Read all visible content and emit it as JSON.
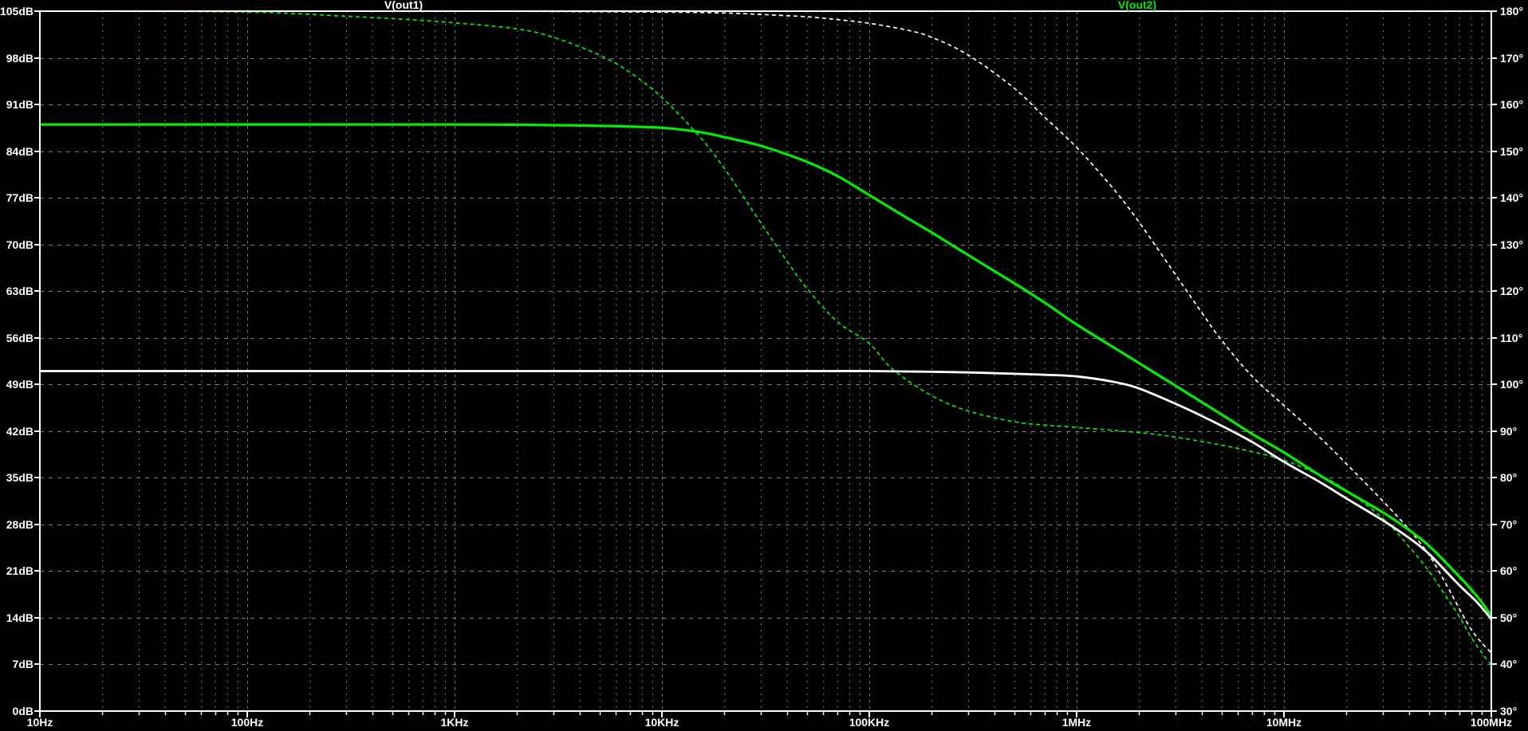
{
  "window": {
    "background_color": "#000000",
    "grid_color": "#7d7d7d",
    "axis_color": "#ffffff"
  },
  "chart_data": {
    "type": "line",
    "title": "",
    "x_axis": {
      "scale": "log",
      "min_hz": 10,
      "max_hz": 100000000,
      "tick_labels": [
        "10Hz",
        "100Hz",
        "1KHz",
        "10KHz",
        "100KHz",
        "1MHz",
        "10MHz",
        "100MHz"
      ]
    },
    "y_left": {
      "quantity": "magnitude",
      "unit": "dB",
      "min": 0,
      "max": 105,
      "step": 7,
      "tick_labels": [
        "105dB",
        "98dB",
        "91dB",
        "84dB",
        "77dB",
        "70dB",
        "63dB",
        "56dB",
        "49dB",
        "42dB",
        "35dB",
        "28dB",
        "21dB",
        "14dB",
        "7dB",
        "0dB"
      ]
    },
    "y_right": {
      "quantity": "phase",
      "unit": "deg",
      "min": 30,
      "max": 180,
      "step": 10,
      "tick_labels": [
        "180°",
        "170°",
        "160°",
        "150°",
        "140°",
        "130°",
        "120°",
        "110°",
        "100°",
        "90°",
        "80°",
        "70°",
        "60°",
        "50°",
        "40°",
        "30°"
      ]
    },
    "grid": true,
    "legend_position": "top",
    "series": [
      {
        "label": "V(out1)",
        "color": "#ffffff",
        "style": "solid",
        "axis": "left",
        "quantity": "magnitude_dB",
        "points": [
          [
            10,
            51
          ],
          [
            100,
            51
          ],
          [
            1000,
            51
          ],
          [
            10000,
            51
          ],
          [
            60000,
            51
          ],
          [
            100000,
            51
          ],
          [
            200000,
            50.9
          ],
          [
            300000,
            50.8
          ],
          [
            500000,
            50.6
          ],
          [
            700000,
            50.45
          ],
          [
            1000000,
            50.2
          ],
          [
            1500000,
            49.4
          ],
          [
            2000000,
            48.4
          ],
          [
            3000000,
            46.1
          ],
          [
            4000000,
            44.3
          ],
          [
            5000000,
            42.8
          ],
          [
            7000000,
            40.4
          ],
          [
            10000000,
            37.4
          ],
          [
            15000000,
            34.3
          ],
          [
            20000000,
            31.9
          ],
          [
            30000000,
            28.6
          ],
          [
            40000000,
            26.0
          ],
          [
            50000000,
            23.6
          ],
          [
            70000000,
            18.9
          ],
          [
            85000000,
            16.4
          ],
          [
            100000000,
            13.8
          ]
        ]
      },
      {
        "label": "V(out1)",
        "color": "#ffffff",
        "style": "dashed",
        "axis": "right",
        "quantity": "phase_deg",
        "points": [
          [
            10,
            180
          ],
          [
            1000,
            180
          ],
          [
            10000,
            179.8
          ],
          [
            20000,
            179.6
          ],
          [
            30000,
            179.3
          ],
          [
            50000,
            178.8
          ],
          [
            70000,
            178.2
          ],
          [
            100000,
            177.4
          ],
          [
            150000,
            176.0
          ],
          [
            200000,
            174.4
          ],
          [
            300000,
            170.6
          ],
          [
            500000,
            163.5
          ],
          [
            700000,
            157.3
          ],
          [
            1000000,
            150.8
          ],
          [
            1500000,
            142.0
          ],
          [
            2000000,
            134.8
          ],
          [
            3000000,
            123.5
          ],
          [
            4000000,
            115.5
          ],
          [
            5000000,
            109.5
          ],
          [
            7000000,
            101.8
          ],
          [
            10000000,
            95.5
          ],
          [
            15000000,
            88.5
          ],
          [
            20000000,
            83.0
          ],
          [
            30000000,
            75.0
          ],
          [
            40000000,
            69.0
          ],
          [
            50000000,
            63.5
          ],
          [
            60000000,
            57.5
          ],
          [
            70000000,
            52.0
          ],
          [
            80000000,
            47.5
          ],
          [
            90000000,
            44.6
          ],
          [
            100000000,
            42.5
          ]
        ]
      },
      {
        "label": "V(out2)",
        "color": "#00ef00",
        "style": "solid",
        "axis": "left",
        "quantity": "magnitude_dB",
        "points": [
          [
            10,
            88
          ],
          [
            1000,
            88
          ],
          [
            3000,
            87.9
          ],
          [
            5000,
            87.8
          ],
          [
            10000,
            87.5
          ],
          [
            15000,
            86.9
          ],
          [
            20000,
            86.1
          ],
          [
            30000,
            84.8
          ],
          [
            50000,
            82.4
          ],
          [
            70000,
            80.3
          ],
          [
            100000,
            77.4
          ],
          [
            150000,
            74.1
          ],
          [
            200000,
            71.8
          ],
          [
            300000,
            68.4
          ],
          [
            500000,
            64.2
          ],
          [
            700000,
            61.3
          ],
          [
            1000000,
            58.0
          ],
          [
            1500000,
            54.6
          ],
          [
            2000000,
            52.2
          ],
          [
            3000000,
            48.8
          ],
          [
            5000000,
            44.5
          ],
          [
            7000000,
            41.6
          ],
          [
            10000000,
            38.8
          ],
          [
            15000000,
            35.3
          ],
          [
            20000000,
            33.0
          ],
          [
            30000000,
            29.8
          ],
          [
            40000000,
            27.2
          ],
          [
            50000000,
            24.8
          ],
          [
            70000000,
            20.2
          ],
          [
            85000000,
            17.3
          ],
          [
            100000000,
            14.3
          ]
        ]
      },
      {
        "label": "V(out2)",
        "color": "#00ef00",
        "style": "dashed",
        "axis": "right",
        "quantity": "phase_deg",
        "points": [
          [
            10,
            180
          ],
          [
            100,
            179.8
          ],
          [
            300,
            178.9
          ],
          [
            500,
            178.4
          ],
          [
            1000,
            177.5
          ],
          [
            2000,
            176.2
          ],
          [
            3000,
            174.4
          ],
          [
            5000,
            170.6
          ],
          [
            7000,
            166.9
          ],
          [
            10000,
            161.5
          ],
          [
            15000,
            153.4
          ],
          [
            20000,
            146.3
          ],
          [
            30000,
            134.6
          ],
          [
            40000,
            126.5
          ],
          [
            50000,
            120.6
          ],
          [
            70000,
            113.5
          ],
          [
            100000,
            108.8
          ],
          [
            130000,
            103.2
          ],
          [
            200000,
            97.6
          ],
          [
            300000,
            94.3
          ],
          [
            500000,
            92.0
          ],
          [
            700000,
            91.3
          ],
          [
            1000000,
            90.8
          ],
          [
            2000000,
            89.7
          ],
          [
            3000000,
            88.7
          ],
          [
            5000000,
            87.0
          ],
          [
            7000000,
            85.6
          ],
          [
            10000000,
            83.8
          ],
          [
            15000000,
            80.5
          ],
          [
            20000000,
            77.3
          ],
          [
            30000000,
            71.3
          ],
          [
            40000000,
            65.3
          ],
          [
            50000000,
            60.0
          ],
          [
            60000000,
            54.8
          ],
          [
            70000000,
            50.3
          ],
          [
            80000000,
            45.8
          ],
          [
            90000000,
            42.5
          ],
          [
            100000000,
            39.8
          ]
        ]
      }
    ]
  }
}
